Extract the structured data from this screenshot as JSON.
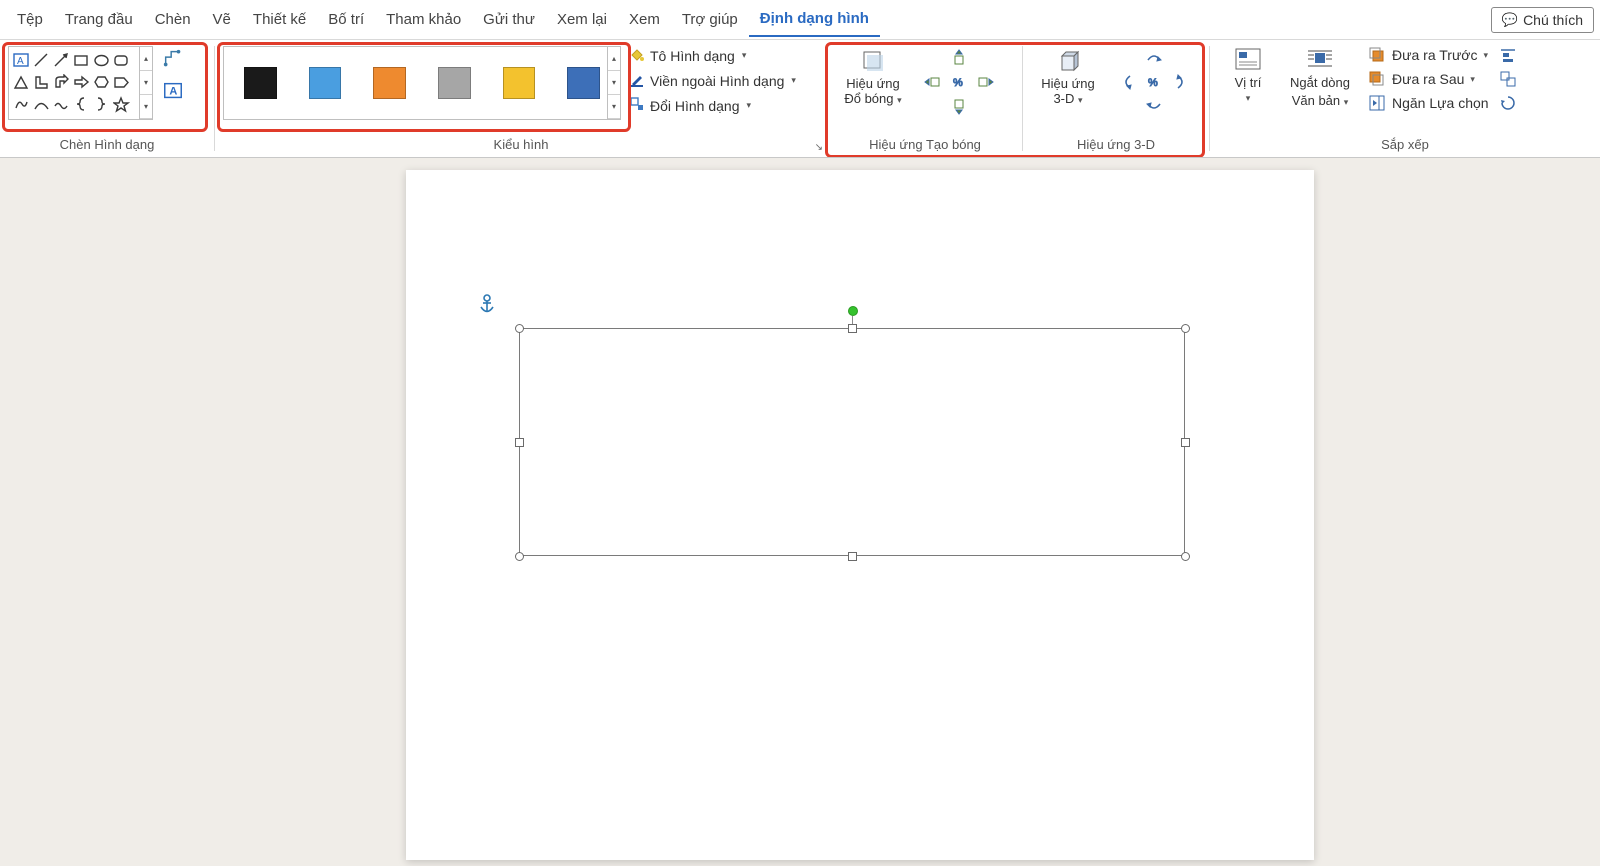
{
  "menu": {
    "items": [
      "Tệp",
      "Trang đầu",
      "Chèn",
      "Vẽ",
      "Thiết kế",
      "Bố trí",
      "Tham khảo",
      "Gửi thư",
      "Xem lại",
      "Xem",
      "Trợ giúp",
      "Định dạng hình"
    ],
    "active_index": 11,
    "annotate": "Chú thích"
  },
  "ribbon": {
    "insert_shapes_label": "Chèn Hình dạng",
    "styles_label": "Kiểu hình",
    "shadow_label": "Hiệu ứng Tạo bóng",
    "threed_label": "Hiệu ứng 3-D",
    "arrange_label": "Sắp xếp",
    "shape_fill": "Tô Hình dạng",
    "shape_outline": "Viền ngoài Hình dạng",
    "change_shape": "Đổi Hình dạng",
    "shadow_btn_l1": "Hiệu ứng",
    "shadow_btn_l2": "Đổ bóng",
    "threed_btn_l1": "Hiệu ứng",
    "threed_btn_l2": "3-D",
    "position": "Vị trí",
    "wrap_l1": "Ngắt dòng",
    "wrap_l2": "Văn bản",
    "bring_forward": "Đưa ra Trước",
    "send_backward": "Đưa ra Sau",
    "selection_pane": "Ngăn Lựa chọn",
    "style_colors": [
      "black",
      "blue",
      "orange",
      "gray",
      "yellow",
      "dblue"
    ]
  }
}
